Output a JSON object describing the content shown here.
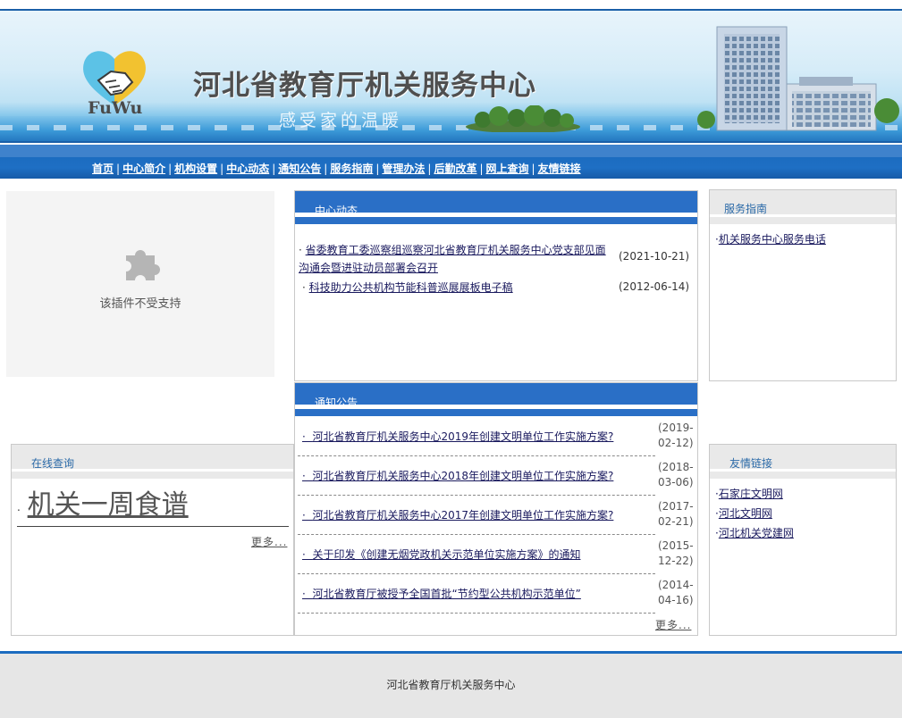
{
  "banner": {
    "logo_text": "FuWu",
    "title": "河北省教育厅机关服务中心",
    "slogan": "感受家的温暖"
  },
  "nav": {
    "items": [
      "首页",
      "中心简介",
      "机构设置",
      "中心动态",
      "通知公告",
      "服务指南",
      "管理办法",
      "后勤改革",
      "网上查询",
      "友情链接"
    ]
  },
  "plugin": {
    "message": "该插件不受支持"
  },
  "center_news": {
    "title": "中心动态",
    "items": [
      {
        "title_line1": "省委教育工委巡察组巡察河北省教育厅机关服务中心党支部见面",
        "title_line2": "沟通会暨进驻动员部署会召开",
        "date": "(2021-10-21)"
      },
      {
        "title_line1": "科技助力公共机构节能科普巡展展板电子稿",
        "title_line2": "",
        "date": "(2012-06-14)"
      }
    ]
  },
  "service_guide": {
    "title": "服务指南",
    "items": [
      "机关服务中心服务电话"
    ]
  },
  "notices": {
    "title": "通知公告",
    "items": [
      {
        "title": "河北省教育厅机关服务中心2019年创建文明单位工作实施方案?",
        "date_line1": "(2019-",
        "date_line2": "02-12)"
      },
      {
        "title": "河北省教育厅机关服务中心2018年创建文明单位工作实施方案?",
        "date_line1": "(2018-",
        "date_line2": "03-06)"
      },
      {
        "title": "河北省教育厅机关服务中心2017年创建文明单位工作实施方案?",
        "date_line1": "(2017-",
        "date_line2": "02-21)"
      },
      {
        "title": "关于印发《创建无烟党政机关示范单位实施方案》的通知",
        "date_line1": "(2015-",
        "date_line2": "12-22)"
      },
      {
        "title": "河北省教育厅被授予全国首批“节约型公共机构示范单位”",
        "date_line1": "(2014-",
        "date_line2": "04-16)"
      }
    ],
    "more": "更多..."
  },
  "online_query": {
    "title": "在线查询",
    "item": "机关一周食谱",
    "more": "更多..."
  },
  "friend_links": {
    "title": "友情链接",
    "items": [
      "石家庄文明网",
      "河北文明网",
      "河北机关党建网"
    ]
  },
  "footer": {
    "text": "河北省教育厅机关服务中心"
  },
  "colors": {
    "nav_blue": "#1e6fc4",
    "panel_blue": "#2a6fc6",
    "link": "#1a1a5e",
    "grey_header": "#e9e9e9"
  }
}
